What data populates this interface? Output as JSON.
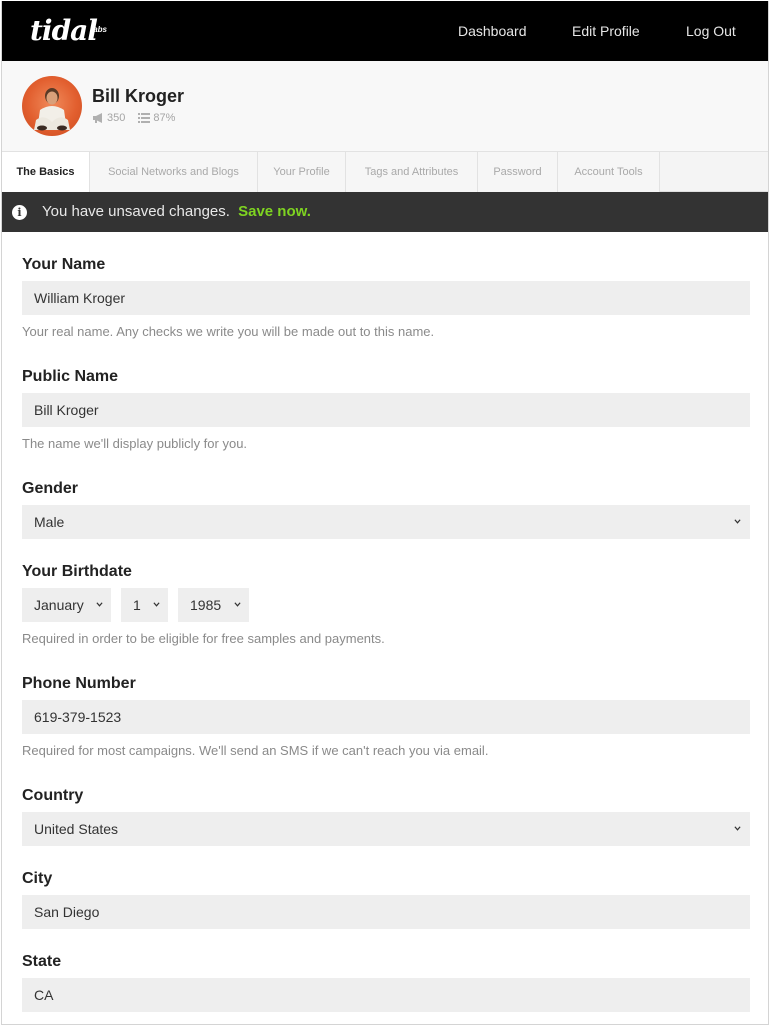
{
  "brand": {
    "logo": "tidal",
    "logo_sup": "labs"
  },
  "nav": {
    "dashboard": "Dashboard",
    "edit_profile": "Edit Profile",
    "log_out": "Log Out"
  },
  "profile": {
    "name": "Bill Kroger",
    "followers": "350",
    "completion": "87%"
  },
  "tabs": [
    {
      "label": "The Basics",
      "active": true
    },
    {
      "label": "Social Networks and Blogs",
      "active": false
    },
    {
      "label": "Your Profile",
      "active": false
    },
    {
      "label": "Tags and Attributes",
      "active": false
    },
    {
      "label": "Password",
      "active": false
    },
    {
      "label": "Account Tools",
      "active": false
    }
  ],
  "alert": {
    "message": "You have unsaved changes.",
    "action": "Save now.",
    "action_color": "#7ed321"
  },
  "form": {
    "your_name": {
      "label": "Your Name",
      "value": "William Kroger",
      "help": "Your real name. Any checks we write you will be made out to this name."
    },
    "public_name": {
      "label": "Public Name",
      "value": "Bill Kroger",
      "help": "The name we'll display publicly for you."
    },
    "gender": {
      "label": "Gender",
      "value": "Male"
    },
    "birthdate": {
      "label": "Your Birthdate",
      "month": "January",
      "day": "1",
      "year": "1985",
      "help": "Required in order to be eligible for free samples and payments."
    },
    "phone": {
      "label": "Phone Number",
      "value": "619-379-1523",
      "help": "Required for most campaigns. We'll send an SMS if we can't reach you via email."
    },
    "country": {
      "label": "Country",
      "value": "United States"
    },
    "city": {
      "label": "City",
      "value": "San Diego"
    },
    "state": {
      "label": "State",
      "value": "CA"
    }
  },
  "colors": {
    "topbar": "#000000",
    "alert_bg": "#333333",
    "field_bg": "#eeeeee"
  }
}
